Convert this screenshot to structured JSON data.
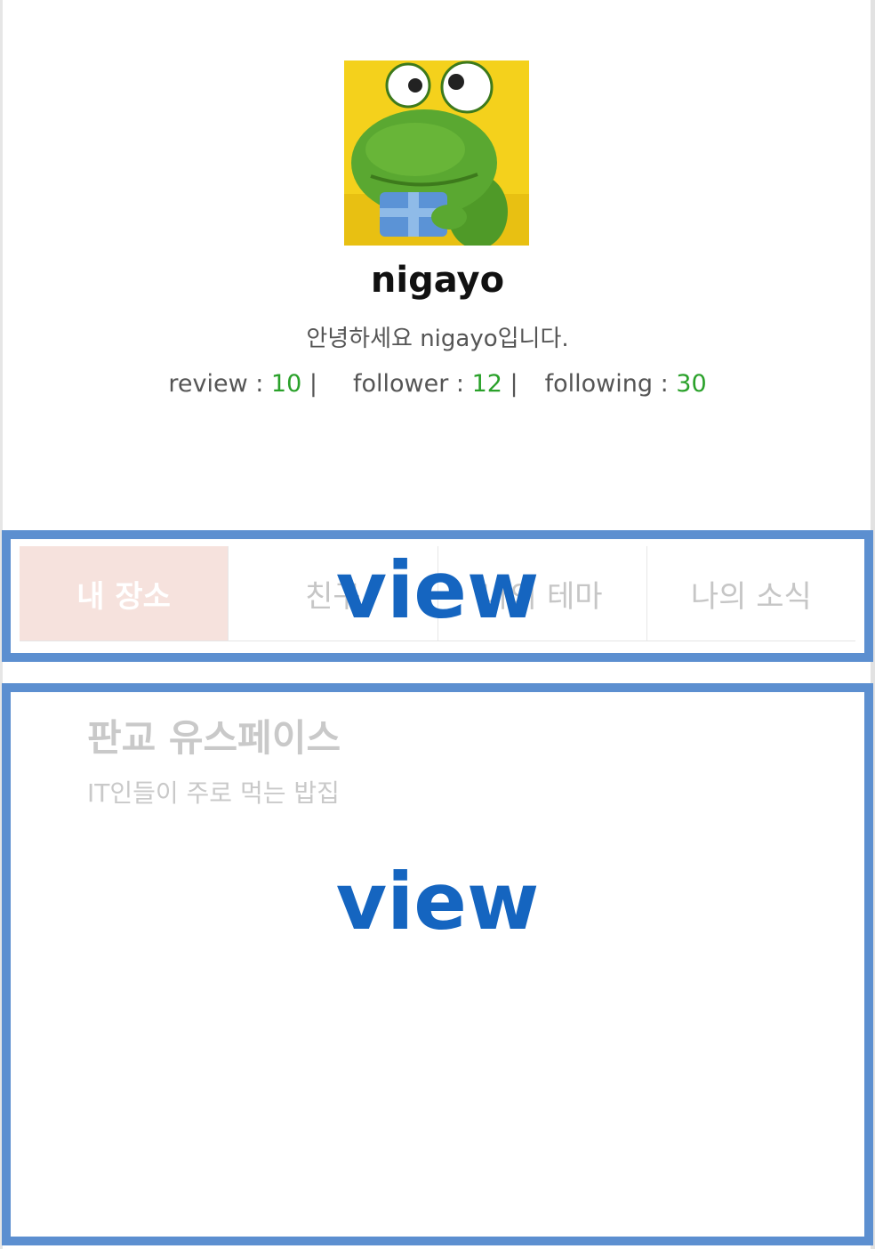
{
  "profile": {
    "username": "nigayo",
    "greeting": "안녕하세요 nigayo입니다.",
    "stats": {
      "review_label": "review : ",
      "review_count": "10",
      "follower_label": "follower : ",
      "follower_count": "12",
      "following_label": "following : ",
      "following_count": "30",
      "separator": " |"
    }
  },
  "tabs": [
    {
      "label": "내 장소",
      "active": true
    },
    {
      "label": "친구",
      "active": false
    },
    {
      "label": "나의 테마",
      "active": false
    },
    {
      "label": "나의 소식",
      "active": false
    }
  ],
  "place": {
    "title": "판교 유스페이스",
    "subtitle": "IT인들이 주로 먹는 밥집"
  },
  "annotations": {
    "top_view_label": "view",
    "bottom_view_label": "view",
    "box_color": "#5c8fd0",
    "label_color": "#1565c0"
  },
  "colors": {
    "count_color": "#2aa12a",
    "active_tab_bg": "#f6e2dd"
  }
}
